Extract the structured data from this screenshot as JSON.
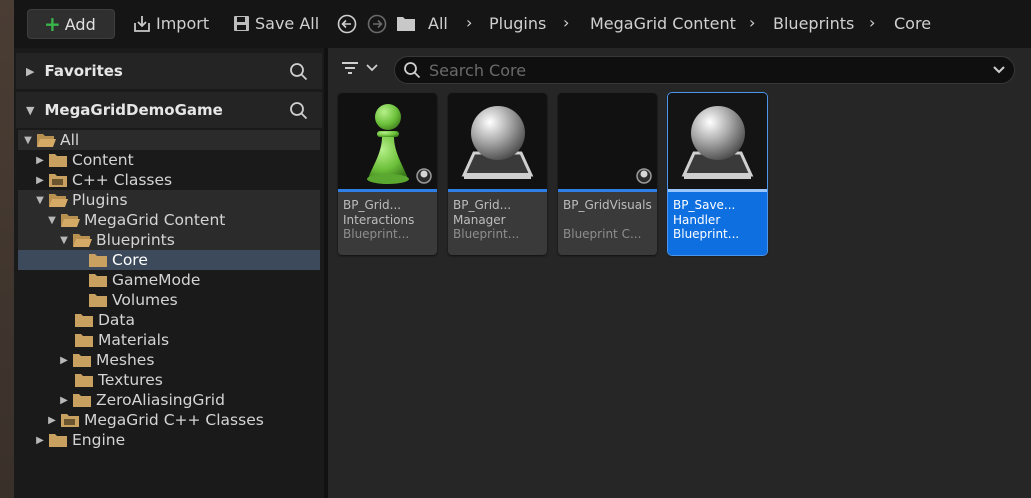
{
  "toolbar": {
    "add_label": "Add",
    "import_label": "Import",
    "save_all_label": "Save All"
  },
  "breadcrumb": [
    "All",
    "Plugins",
    "MegaGrid Content",
    "Blueprints",
    "Core"
  ],
  "sections": {
    "favorites": "Favorites",
    "project": "MegaGridDemoGame"
  },
  "tree": {
    "all": "All",
    "content": "Content",
    "cpp_classes": "C++ Classes",
    "plugins": "Plugins",
    "megagrid_content": "MegaGrid Content",
    "blueprints": "Blueprints",
    "core": "Core",
    "gamemode": "GameMode",
    "volumes": "Volumes",
    "data": "Data",
    "materials": "Materials",
    "meshes": "Meshes",
    "textures": "Textures",
    "zeroaliasing": "ZeroAliasingGrid",
    "megagrid_cpp": "MegaGrid C++ Classes",
    "engine": "Engine"
  },
  "search": {
    "placeholder": "Search Core"
  },
  "assets": [
    {
      "line1": "BP_Grid...",
      "line2": "Interactions",
      "line3": "Blueprint...",
      "thumb": "green-pawn-icon"
    },
    {
      "line1": "BP_Grid...",
      "line2": "Manager",
      "line3": "Blueprint...",
      "thumb": "sphere-icon"
    },
    {
      "line1": "BP_GridVisuals",
      "line2": "",
      "line3": "Blueprint C...",
      "thumb": "checker-icon"
    },
    {
      "line1": "BP_Save...",
      "line2": "Handler",
      "line3": "Blueprint...",
      "thumb": "sphere-icon"
    }
  ],
  "colors": {
    "accent": "#0e6fe0",
    "add_plus": "#39b54a",
    "folder": "#c8a060",
    "selected_row": "#3d4a5c"
  }
}
